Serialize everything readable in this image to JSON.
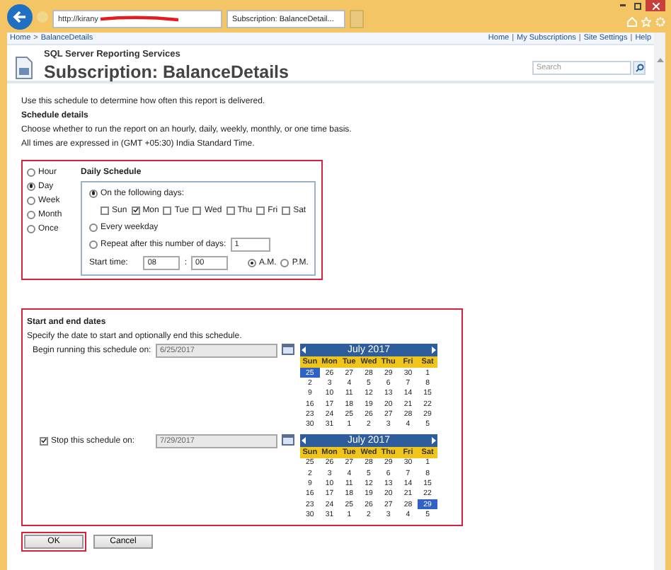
{
  "browser": {
    "address": "http://kirany",
    "tab_title": "Subscription: BalanceDetail..."
  },
  "breadcrumb": {
    "items": [
      "Home",
      "BalanceDetails"
    ],
    "separator": ">"
  },
  "top_links": {
    "items": [
      "Home",
      "My Subscriptions",
      "Site Settings",
      "Help"
    ],
    "separator": "|"
  },
  "header": {
    "product": "SQL Server Reporting Services",
    "title": "Subscription: BalanceDetails"
  },
  "search": {
    "placeholder": "Search"
  },
  "intro": "Use this schedule to determine how often this report is delivered.",
  "schedule_details": {
    "heading": "Schedule details",
    "description": "Choose whether to run the report on an hourly, daily, weekly, monthly, or one time basis.",
    "timezone": "All times are expressed in (GMT +05:30) India Standard Time."
  },
  "frequency": {
    "annotated": true,
    "options": [
      {
        "label": "Hour",
        "selected": false
      },
      {
        "label": "Day",
        "selected": true
      },
      {
        "label": "Week",
        "selected": false
      },
      {
        "label": "Month",
        "selected": false
      },
      {
        "label": "Once",
        "selected": false
      }
    ]
  },
  "daily": {
    "heading": "Daily Schedule",
    "options": [
      {
        "kind": "days",
        "label": "On the following days:",
        "selected": true
      },
      {
        "kind": "plain",
        "label": "Every weekday",
        "selected": false
      },
      {
        "kind": "repeat",
        "label": "Repeat after this number of days:",
        "selected": false,
        "value": "1"
      }
    ],
    "days": [
      {
        "label": "Sun",
        "checked": false
      },
      {
        "label": "Mon",
        "checked": true
      },
      {
        "label": "Tue",
        "checked": false
      },
      {
        "label": "Wed",
        "checked": false
      },
      {
        "label": "Thu",
        "checked": false
      },
      {
        "label": "Fri",
        "checked": false
      },
      {
        "label": "Sat",
        "checked": false
      }
    ],
    "start_time": {
      "label": "Start time:",
      "hour": "08",
      "separator": ":",
      "minute": "00"
    },
    "meridiem": [
      {
        "label": "A.M.",
        "selected": true
      },
      {
        "label": "P.M.",
        "selected": false
      }
    ]
  },
  "dates": {
    "annotated": true,
    "heading": "Start and end dates",
    "description": "Specify the date to start and optionally end this schedule.",
    "rows": [
      {
        "kind": "begin",
        "label": "Begin running this schedule on:",
        "value": "6/25/2017",
        "calendar": {
          "month": "July 2017",
          "weekdays": [
            "Sun",
            "Mon",
            "Tue",
            "Wed",
            "Thu",
            "Fri",
            "Sat"
          ],
          "weeks": [
            [
              {
                "d": "25",
                "selected": true
              },
              {
                "d": "26",
                "selected": false
              },
              {
                "d": "27",
                "selected": false
              },
              {
                "d": "28",
                "selected": false
              },
              {
                "d": "29",
                "selected": false
              },
              {
                "d": "30",
                "selected": false
              },
              {
                "d": "1",
                "selected": false
              }
            ],
            [
              {
                "d": "2",
                "selected": false
              },
              {
                "d": "3",
                "selected": false
              },
              {
                "d": "4",
                "selected": false
              },
              {
                "d": "5",
                "selected": false
              },
              {
                "d": "6",
                "selected": false
              },
              {
                "d": "7",
                "selected": false
              },
              {
                "d": "8",
                "selected": false
              }
            ],
            [
              {
                "d": "9",
                "selected": false
              },
              {
                "d": "10",
                "selected": false
              },
              {
                "d": "11",
                "selected": false
              },
              {
                "d": "12",
                "selected": false
              },
              {
                "d": "13",
                "selected": false
              },
              {
                "d": "14",
                "selected": false
              },
              {
                "d": "15",
                "selected": false
              }
            ],
            [
              {
                "d": "16",
                "selected": false
              },
              {
                "d": "17",
                "selected": false
              },
              {
                "d": "18",
                "selected": false
              },
              {
                "d": "19",
                "selected": false
              },
              {
                "d": "20",
                "selected": false
              },
              {
                "d": "21",
                "selected": false
              },
              {
                "d": "22",
                "selected": false
              }
            ],
            [
              {
                "d": "23",
                "selected": false
              },
              {
                "d": "24",
                "selected": false
              },
              {
                "d": "25",
                "selected": false
              },
              {
                "d": "26",
                "selected": false
              },
              {
                "d": "27",
                "selected": false
              },
              {
                "d": "28",
                "selected": false
              },
              {
                "d": "29",
                "selected": false
              }
            ],
            [
              {
                "d": "30",
                "selected": false
              },
              {
                "d": "31",
                "selected": false
              },
              {
                "d": "1",
                "selected": false
              },
              {
                "d": "2",
                "selected": false
              },
              {
                "d": "3",
                "selected": false
              },
              {
                "d": "4",
                "selected": false
              },
              {
                "d": "5",
                "selected": false
              }
            ]
          ]
        }
      },
      {
        "kind": "stop",
        "label": "Stop this schedule on:",
        "checked": true,
        "value": "7/29/2017",
        "calendar": {
          "month": "July 2017",
          "weekdays": [
            "Sun",
            "Mon",
            "Tue",
            "Wed",
            "Thu",
            "Fri",
            "Sat"
          ],
          "weeks": [
            [
              {
                "d": "25",
                "selected": false
              },
              {
                "d": "26",
                "selected": false
              },
              {
                "d": "27",
                "selected": false
              },
              {
                "d": "28",
                "selected": false
              },
              {
                "d": "29",
                "selected": false
              },
              {
                "d": "30",
                "selected": false
              },
              {
                "d": "1",
                "selected": false
              }
            ],
            [
              {
                "d": "2",
                "selected": false
              },
              {
                "d": "3",
                "selected": false
              },
              {
                "d": "4",
                "selected": false
              },
              {
                "d": "5",
                "selected": false
              },
              {
                "d": "6",
                "selected": false
              },
              {
                "d": "7",
                "selected": false
              },
              {
                "d": "8",
                "selected": false
              }
            ],
            [
              {
                "d": "9",
                "selected": false
              },
              {
                "d": "10",
                "selected": false
              },
              {
                "d": "11",
                "selected": false
              },
              {
                "d": "12",
                "selected": false
              },
              {
                "d": "13",
                "selected": false
              },
              {
                "d": "14",
                "selected": false
              },
              {
                "d": "15",
                "selected": false
              }
            ],
            [
              {
                "d": "16",
                "selected": false
              },
              {
                "d": "17",
                "selected": false
              },
              {
                "d": "18",
                "selected": false
              },
              {
                "d": "19",
                "selected": false
              },
              {
                "d": "20",
                "selected": false
              },
              {
                "d": "21",
                "selected": false
              },
              {
                "d": "22",
                "selected": false
              }
            ],
            [
              {
                "d": "23",
                "selected": false
              },
              {
                "d": "24",
                "selected": false
              },
              {
                "d": "25",
                "selected": false
              },
              {
                "d": "26",
                "selected": false
              },
              {
                "d": "27",
                "selected": false
              },
              {
                "d": "28",
                "selected": false
              },
              {
                "d": "29",
                "selected": true
              }
            ],
            [
              {
                "d": "30",
                "selected": false
              },
              {
                "d": "31",
                "selected": false
              },
              {
                "d": "1",
                "selected": false
              },
              {
                "d": "2",
                "selected": false
              },
              {
                "d": "3",
                "selected": false
              },
              {
                "d": "4",
                "selected": false
              },
              {
                "d": "5",
                "selected": false
              }
            ]
          ]
        }
      }
    ]
  },
  "buttons": [
    {
      "label": "OK",
      "annotated": true
    },
    {
      "label": "Cancel",
      "annotated": false
    }
  ]
}
